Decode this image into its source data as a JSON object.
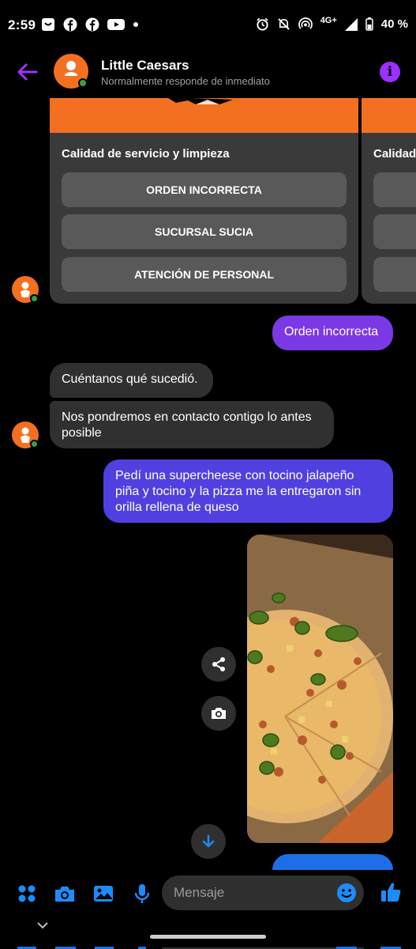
{
  "status_bar": {
    "time": "2:59",
    "network": "4G+",
    "battery": "40 %"
  },
  "header": {
    "name": "Little Caesars",
    "subtitle": "Normalmente responde de inmediato"
  },
  "card": {
    "title": "Calidad de servicio y limpieza",
    "buttons": [
      "ORDEN INCORRECTA",
      "SUCURSAL SUCIA",
      "ATENCIÓN DE PERSONAL"
    ],
    "next_card_title": "Calidad"
  },
  "messages": {
    "sent_1": "Orden incorrecta",
    "recv_1": "Cuéntanos qué sucedió.",
    "recv_2": "Nos pondremos en contacto contigo lo antes posible",
    "sent_2": "Pedí una supercheese con tocino jalapeño piña y tocino y la pizza me la entregaron sin orilla rellena de queso"
  },
  "composer": {
    "placeholder": "Mensaje"
  },
  "colors": {
    "brand_orange": "#f37021",
    "accent_purple": "#7b39e6",
    "accent_indigo": "#5140e0",
    "messenger_blue": "#1d6fe8"
  }
}
